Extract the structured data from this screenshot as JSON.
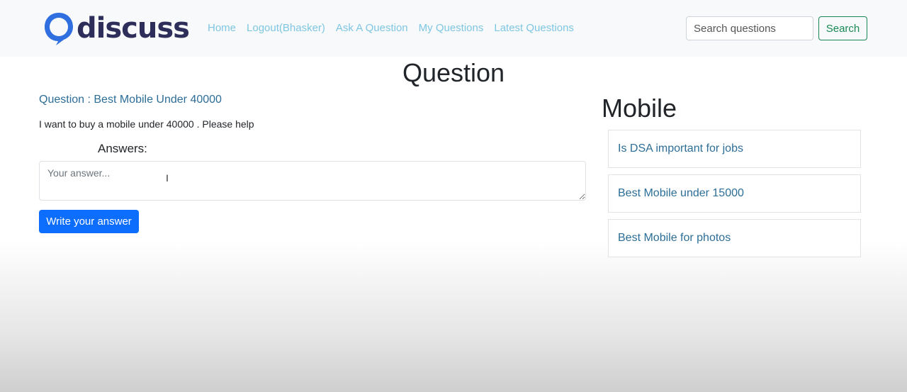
{
  "header": {
    "logo_text": "discuss",
    "nav": [
      "Home",
      "Logout(Bhasker)",
      "Ask A Question",
      "My Questions",
      "Latest Questions"
    ],
    "search": {
      "placeholder": "Search questions",
      "button_label": "Search"
    }
  },
  "colors": {
    "logo_blue": "#2f6fe0",
    "logo_text": "#2d2e5a",
    "nav_link": "#7fc6e3",
    "primary": "#0d6efd",
    "success": "#198754",
    "link": "#2c6e97"
  },
  "main": {
    "page_title": "Question",
    "question_title": "Question : Best Mobile Under 40000",
    "question_body": "I want to buy a mobile under 40000 . Please help",
    "answers_label": "Answers:",
    "answer_placeholder": "Your answer...",
    "submit_label": "Write your answer"
  },
  "sidebar": {
    "title": "Mobile",
    "items": [
      "Is DSA important for jobs",
      "Best Mobile under 15000",
      "Best Mobile for photos"
    ]
  }
}
